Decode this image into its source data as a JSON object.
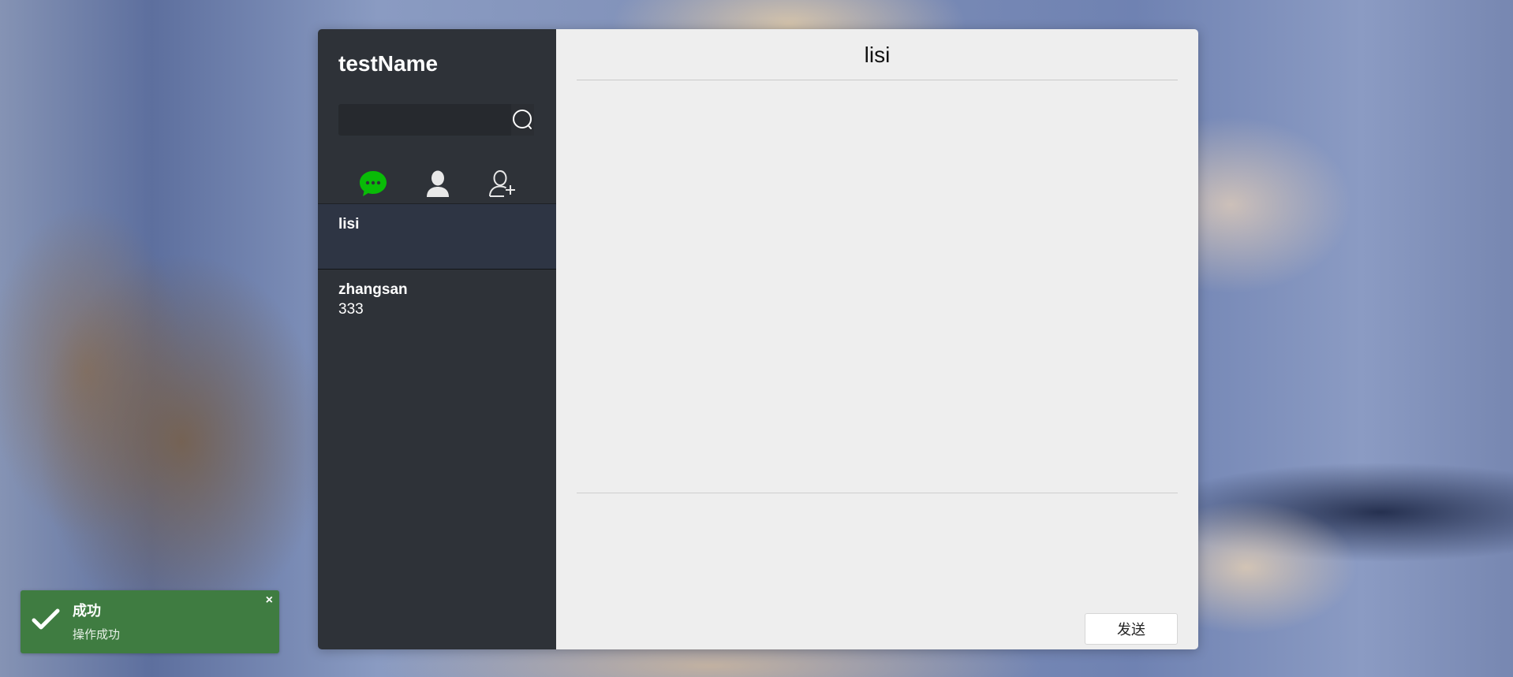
{
  "user": {
    "name": "testName"
  },
  "search": {
    "placeholder": "",
    "value": ""
  },
  "tabs": [
    {
      "name": "chat",
      "icon": "chat-bubble-icon",
      "active": true,
      "color": "#09bb07"
    },
    {
      "name": "contacts",
      "icon": "person-icon",
      "active": false
    },
    {
      "name": "add-friend",
      "icon": "add-person-icon",
      "active": false
    }
  ],
  "sessions": [
    {
      "name": "lisi",
      "last_message": "",
      "active": true
    },
    {
      "name": "zhangsan",
      "last_message": "333",
      "active": false
    }
  ],
  "chat": {
    "title": "lisi",
    "compose_value": "",
    "send_label": "发送"
  },
  "toast": {
    "title": "成功",
    "message": "操作成功",
    "close": "×",
    "color": "#3f7c41"
  }
}
